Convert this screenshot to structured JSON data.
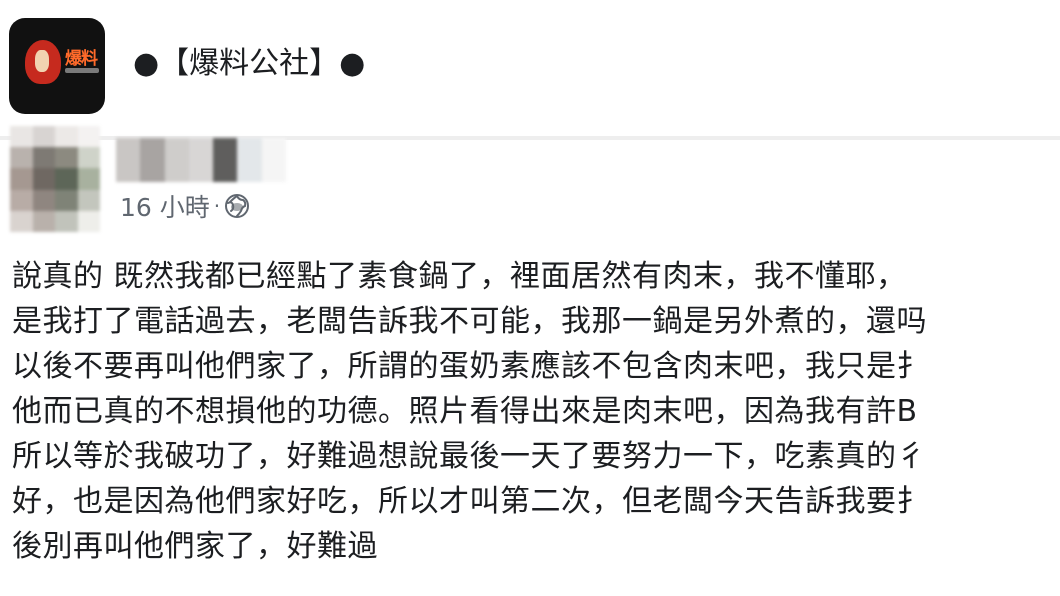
{
  "group": {
    "logo_text": "爆料",
    "name": "●【爆料公社】●"
  },
  "post": {
    "time": "16 小時",
    "separator": "·",
    "privacy_icon": "globe-icon",
    "lines": [
      "說真的 既然我都已經點了素食鍋了，裡面居然有肉末，我不懂耶，",
      "是我打了電話過去，老闆告訴我不可能，我那一鍋是另外煮的，還吗",
      "以後不要再叫他們家了，所謂的蛋奶素應該不包含肉末吧，我只是扌",
      "他而已真的不想損他的功德。照片看得出來是肉末吧，因為我有許B",
      "所以等於我破功了，好難過想說最後一天了要努力一下，吃素真的彳",
      "好，也是因為他們家好吃，所以才叫第二次，但老闆今天告訴我要扌",
      "後別再叫他們家了，好難過"
    ]
  },
  "colors": {
    "text": "#1c1e21",
    "meta_text": "#606770",
    "logo_bg": "#111111",
    "logo_accent": "#ff6a2a"
  }
}
